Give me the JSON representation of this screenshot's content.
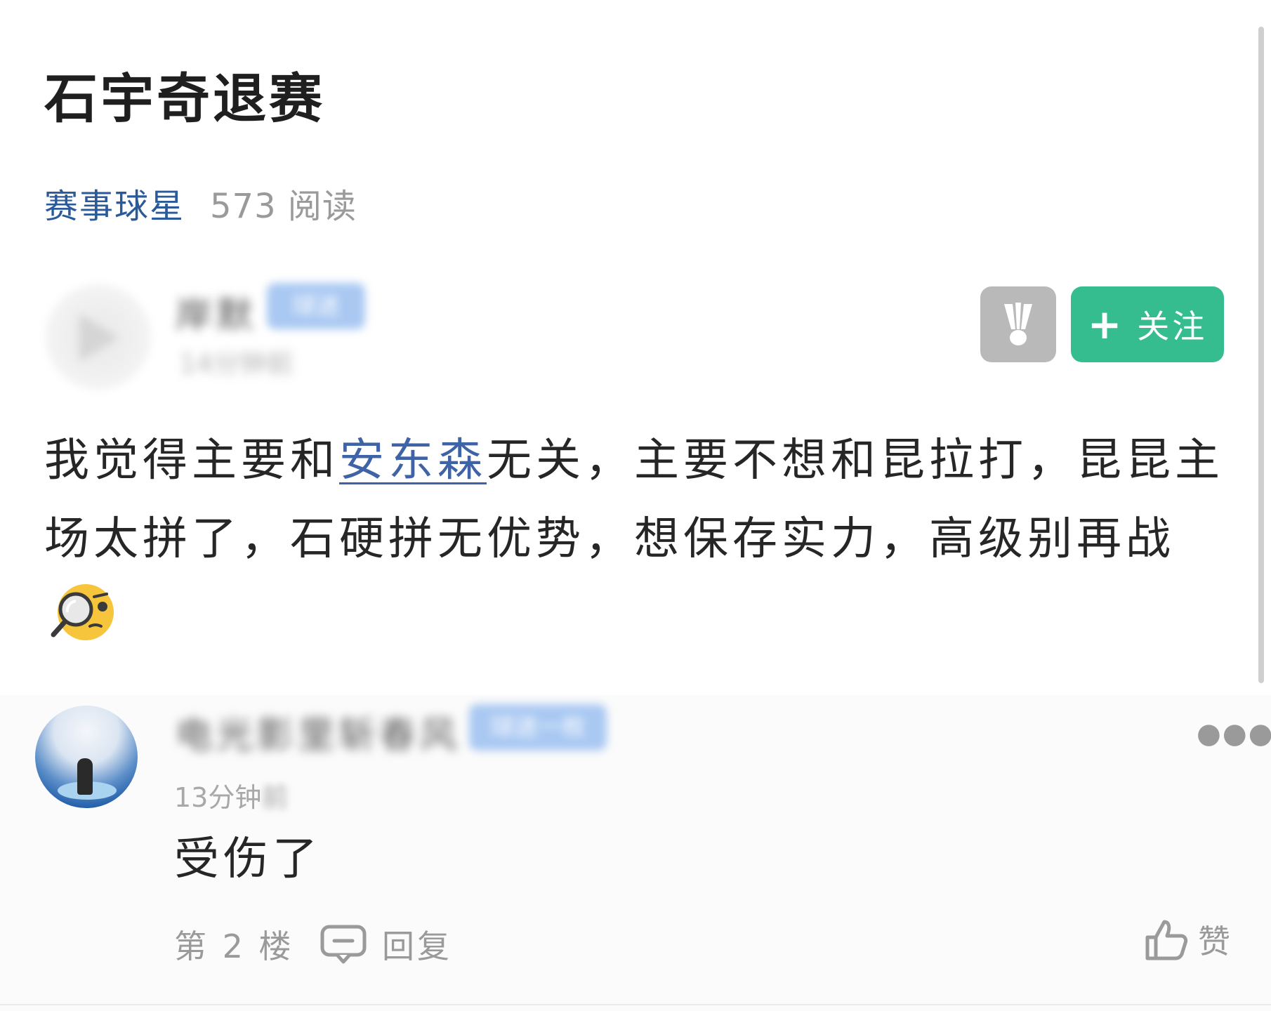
{
  "post": {
    "title": "石宇奇退赛",
    "category": "赛事球星",
    "reads": "573 阅读"
  },
  "author": {
    "name_blurred": "岸默",
    "badge_blurred": "球迷",
    "time_blurred": "14分钟前",
    "follow_label": "关注",
    "follow_icon": "plus-icon",
    "shuttle_icon": "shuttlecock-icon"
  },
  "body": {
    "text_before": "我觉得主要和",
    "mention": "安东森",
    "text_after": "无关，主要不想和昆拉打，昆昆主场太拼了，石硬拼无优势，想保存实力，高级别再战",
    "emoji": "search-emoji"
  },
  "reply": {
    "name_blurred": "电光影里斩春风",
    "badge_blurred": "球迷一枚",
    "time_visible": "13分钟",
    "time_blurred": "前",
    "text": "受伤了",
    "floor": "第 2 楼",
    "reply_label": "回复",
    "like_label": "赞",
    "more_icon": "more-dots-icon"
  },
  "colors": {
    "accent_green": "#35bd8f",
    "mention_blue": "#3e63a6",
    "category_blue": "#2a5a9a",
    "badge_blue": "#a9c8f2"
  }
}
